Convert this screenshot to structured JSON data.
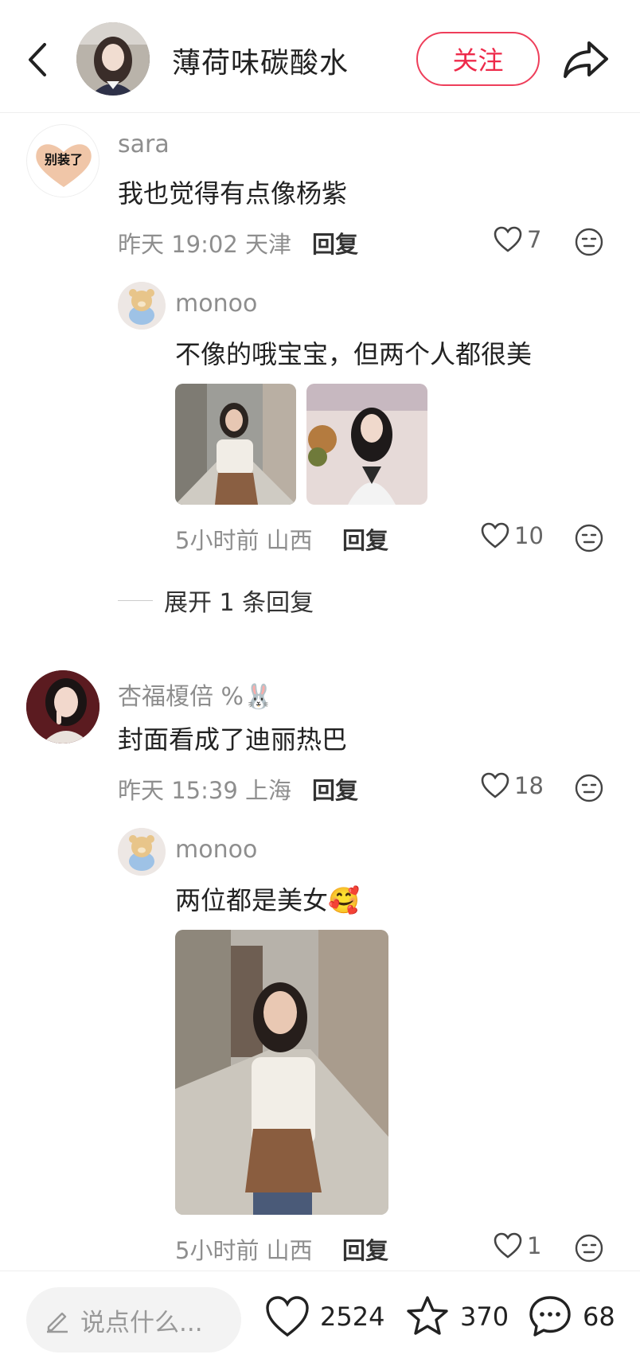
{
  "header": {
    "author_name": "薄荷味碳酸水",
    "follow_label": "关注"
  },
  "comments": [
    {
      "username": "sara",
      "avatar_text": "别装了",
      "text": "我也觉得有点像杨紫",
      "meta": "昨天 19:02 天津",
      "reply_label": "回复",
      "likes": "7",
      "replies": [
        {
          "username": "monoo",
          "text": "不像的哦宝宝，但两个人都很美",
          "meta": "5小时前 山西",
          "reply_label": "回复",
          "likes": "10"
        }
      ],
      "expand_label": "展开 1 条回复"
    },
    {
      "username": "杏福榎倍 %🐰",
      "text": "封面看成了迪丽热巴",
      "meta": "昨天 15:39 上海",
      "reply_label": "回复",
      "likes": "18",
      "replies": [
        {
          "username": "monoo",
          "text": "两位都是美女🥰",
          "meta": "5小时前 山西",
          "reply_label": "回复",
          "likes": "1"
        }
      ]
    }
  ],
  "bottom_bar": {
    "input_placeholder": "说点什么...",
    "likes": "2524",
    "stars": "370",
    "comments": "68"
  },
  "colors": {
    "accent": "#ee2a4a",
    "muted_text": "#8e8e8e"
  },
  "icons": [
    "back-icon",
    "share-icon",
    "heart-icon",
    "face-icon",
    "pencil-icon",
    "star-icon",
    "comment-bubble-icon"
  ]
}
